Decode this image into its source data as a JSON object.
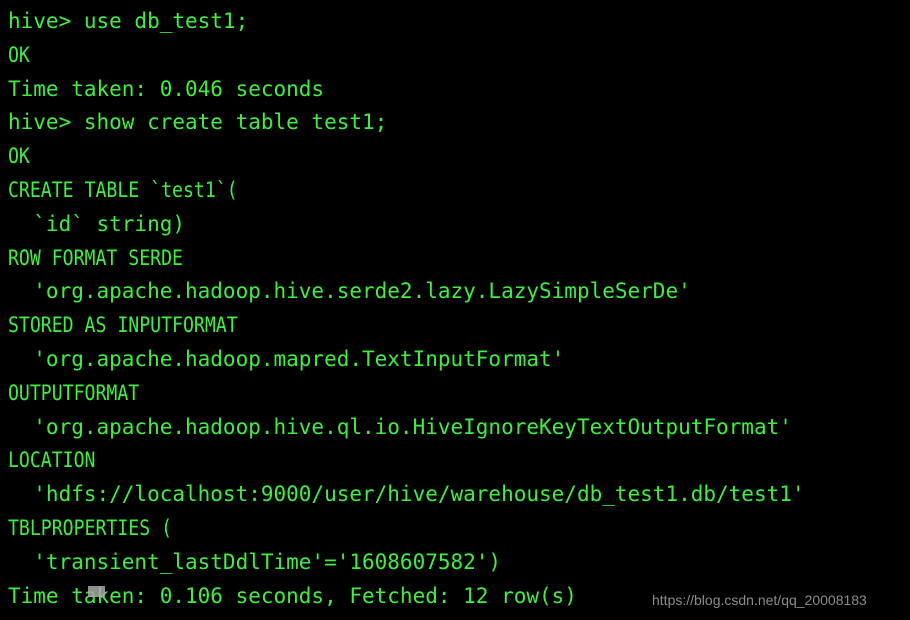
{
  "terminal": {
    "background_color": "#000000",
    "text_color": "#3ef03e",
    "cursor_color": "#a8a8a8",
    "lines": [
      {
        "text": "hive> use db_test1;",
        "condensed": false
      },
      {
        "text": "OK",
        "condensed": true
      },
      {
        "text": "Time taken: 0.046 seconds",
        "condensed": false
      },
      {
        "text": "hive> show create table test1;",
        "condensed": false
      },
      {
        "text": "OK",
        "condensed": true
      },
      {
        "text": "CREATE TABLE `test1`(",
        "condensed": true
      },
      {
        "text": "  `id` string)",
        "condensed": false
      },
      {
        "text": "ROW FORMAT SERDE",
        "condensed": true
      },
      {
        "text": "  'org.apache.hadoop.hive.serde2.lazy.LazySimpleSerDe'",
        "condensed": false
      },
      {
        "text": "STORED AS INPUTFORMAT",
        "condensed": true
      },
      {
        "text": "  'org.apache.hadoop.mapred.TextInputFormat'",
        "condensed": false
      },
      {
        "text": "OUTPUTFORMAT",
        "condensed": true
      },
      {
        "text": "  'org.apache.hadoop.hive.ql.io.HiveIgnoreKeyTextOutputFormat'",
        "condensed": false
      },
      {
        "text": "LOCATION",
        "condensed": true
      },
      {
        "text": "  'hdfs://localhost:9000/user/hive/warehouse/db_test1.db/test1'",
        "condensed": false
      },
      {
        "text": "TBLPROPERTIES (",
        "condensed": true
      },
      {
        "text": "  'transient_lastDdlTime'='1608607582')",
        "condensed": false
      },
      {
        "text": "Time taken: 0.106 seconds, Fetched: 12 row(s)",
        "condensed": false
      }
    ]
  },
  "watermark": {
    "text": "https://blog.csdn.net/qq_20008183",
    "color": "#8c8c8c"
  }
}
